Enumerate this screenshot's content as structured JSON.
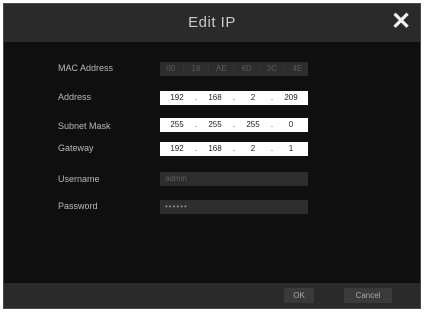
{
  "dialog": {
    "title": "Edit IP",
    "close_icon": "close-icon"
  },
  "form": {
    "mac_label": "MAC Address",
    "mac_segments": [
      "00",
      "18",
      "AE",
      "6D",
      "3C",
      "4E"
    ],
    "address_label": "Address",
    "address_segments": [
      "192",
      "168",
      "2",
      "209"
    ],
    "subnet_label": "Subnet Mask",
    "subnet_segments": [
      "255",
      "255",
      "255",
      "0"
    ],
    "gateway_label": "Gateway",
    "gateway_segments": [
      "192",
      "168",
      "2",
      "1"
    ],
    "username_label": "Username",
    "username_value": "admin",
    "password_label": "Password",
    "password_value": "••••••"
  },
  "buttons": {
    "ok_label": "OK",
    "cancel_label": "Cancel"
  },
  "colors": {
    "background": "#0f0f0f",
    "bar": "#2a2a2a",
    "field": "#ffffff"
  }
}
